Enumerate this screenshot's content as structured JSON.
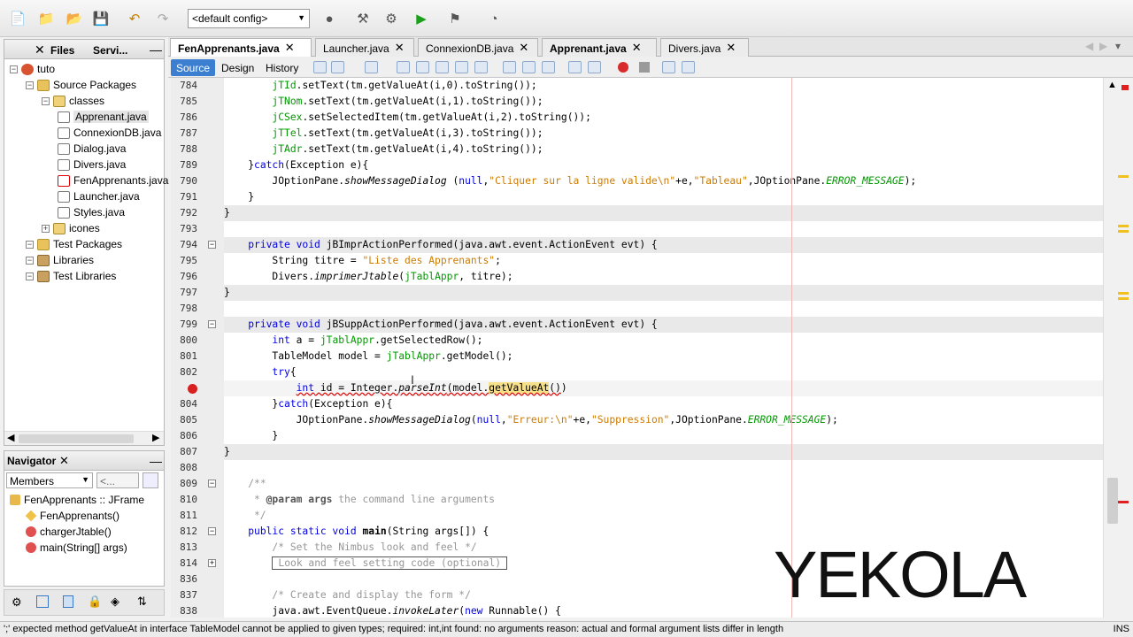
{
  "toolbar": {
    "config": "<default config>"
  },
  "projects_panel": {
    "tabs": [
      "Files",
      "Servi..."
    ],
    "tree": [
      {
        "label": "tuto",
        "depth": 0,
        "icon": "project-icon"
      },
      {
        "label": "Source Packages",
        "depth": 1,
        "icon": "package-folder-icon"
      },
      {
        "label": "classes",
        "depth": 2,
        "icon": "package-icon"
      },
      {
        "label": "Apprenant.java",
        "depth": 3,
        "icon": "java-file-icon",
        "selected": true
      },
      {
        "label": "ConnexionDB.java",
        "depth": 3,
        "icon": "java-file-icon"
      },
      {
        "label": "Dialog.java",
        "depth": 3,
        "icon": "java-file-icon"
      },
      {
        "label": "Divers.java",
        "depth": 3,
        "icon": "java-file-icon"
      },
      {
        "label": "FenApprenants.java",
        "depth": 3,
        "icon": "java-file-error-icon"
      },
      {
        "label": "Launcher.java",
        "depth": 3,
        "icon": "java-file-icon"
      },
      {
        "label": "Styles.java",
        "depth": 3,
        "icon": "java-file-icon"
      },
      {
        "label": "icones",
        "depth": 2,
        "icon": "package-icon"
      },
      {
        "label": "Test Packages",
        "depth": 1,
        "icon": "package-folder-icon"
      },
      {
        "label": "Libraries",
        "depth": 1,
        "icon": "library-icon"
      },
      {
        "label": "Test Libraries",
        "depth": 1,
        "icon": "library-icon"
      }
    ]
  },
  "navigator": {
    "title": "Navigator",
    "filter": "Members",
    "filter2": "<...",
    "items": [
      {
        "label": "FenApprenants :: JFrame",
        "depth": 0
      },
      {
        "label": "FenApprenants()",
        "depth": 1
      },
      {
        "label": "chargerJtable()",
        "depth": 1
      },
      {
        "label": "main(String[] args)",
        "depth": 1
      }
    ]
  },
  "editor": {
    "tabs": [
      {
        "label": "FenApprenants.java",
        "active": true
      },
      {
        "label": "Launcher.java"
      },
      {
        "label": "ConnexionDB.java"
      },
      {
        "label": "Apprenant.java",
        "bold": true
      },
      {
        "label": "Divers.java"
      }
    ],
    "modes": [
      "Source",
      "Design",
      "History"
    ],
    "lines": [
      {
        "n": "784",
        "html": "        <span class='fld'>jTId</span>.setText(tm.getValueAt(i,0).toString());"
      },
      {
        "n": "785",
        "html": "        <span class='fld'>jTNom</span>.setText(tm.getValueAt(i,1).toString());"
      },
      {
        "n": "786",
        "html": "        <span class='fld'>jCSex</span>.setSelectedItem(tm.getValueAt(i,2).toString());"
      },
      {
        "n": "787",
        "html": "        <span class='fld'>jTTel</span>.setText(tm.getValueAt(i,3).toString());"
      },
      {
        "n": "788",
        "html": "        <span class='fld'>jTAdr</span>.setText(tm.getValueAt(i,4).toString());"
      },
      {
        "n": "789",
        "html": "    }<span class='kw'>catch</span>(Exception e){"
      },
      {
        "n": "790",
        "html": "        JOptionPane.<span class='it'>showMessageDialog</span> (<span class='kw'>null</span>,<span class='str'>\"Cliquer sur la ligne valide\\n\"</span>+e,<span class='str'>\"Tableau\"</span>,JOptionPane.<span class='cst'>ERROR_MESSAGE</span>);"
      },
      {
        "n": "791",
        "html": "    }"
      },
      {
        "n": "792",
        "html": "}",
        "cls": "hl"
      },
      {
        "n": "793",
        "html": ""
      },
      {
        "n": "794",
        "html": "    <span class='kw'>private void</span> jBImprActionPerformed(java.awt.event.ActionEvent evt) {",
        "cls": "hl",
        "fold": "-"
      },
      {
        "n": "795",
        "html": "        String titre = <span class='str'>\"Liste des Apprenants\"</span>;"
      },
      {
        "n": "796",
        "html": "        Divers.<span class='it'>imprimerJtable</span>(<span class='fld'>jTablAppr</span>, titre);"
      },
      {
        "n": "797",
        "html": "}",
        "cls": "hl"
      },
      {
        "n": "798",
        "html": ""
      },
      {
        "n": "799",
        "html": "    <span class='kw'>private void</span> jBSuppActionPerformed(java.awt.event.ActionEvent evt) {",
        "cls": "hl",
        "fold": "-"
      },
      {
        "n": "800",
        "html": "        <span class='kw'>int</span> a = <span class='fld'>jTablAppr</span>.getSelectedRow();"
      },
      {
        "n": "801",
        "html": "        TableModel model = <span class='fld'>jTablAppr</span>.getModel();"
      },
      {
        "n": "802",
        "html": "        <span class='kw'>try</span>{"
      },
      {
        "n": "803",
        "html": "            <span class='err'><span class='kw'>int</span> id = Integer.<span class='it'>parseInt</span>(model.<span style='background:#f7e08a'>getValueAt</span>()</span>)",
        "cls": "cur",
        "error": true
      },
      {
        "n": "804",
        "html": "        }<span class='kw'>catch</span>(Exception e){"
      },
      {
        "n": "805",
        "html": "            JOptionPane.<span class='it'>showMessageDialog</span>(<span class='kw'>null</span>,<span class='str'>\"Erreur:\\n\"</span>+e,<span class='str'>\"Suppression\"</span>,JOptionPane.<span class='cst'>ERROR_MESSAGE</span>);"
      },
      {
        "n": "806",
        "html": "        }"
      },
      {
        "n": "807",
        "html": "}",
        "cls": "hl"
      },
      {
        "n": "808",
        "html": ""
      },
      {
        "n": "809",
        "html": "    <span class='cm'>/**</span>",
        "fold": "-"
      },
      {
        "n": "810",
        "html": "<span class='cm'>     * <b style='color:#555'>@param</b> <b style='color:#555'>args</b> the command line arguments</span>"
      },
      {
        "n": "811",
        "html": "<span class='cm'>     */</span>"
      },
      {
        "n": "812",
        "html": "    <span class='kw'>public static void</span> <b>main</b>(String args[]) {",
        "fold": "-"
      },
      {
        "n": "813",
        "html": "        <span class='cm'>/* Set the Nimbus look and feel */</span>"
      },
      {
        "n": "814",
        "html": "        <span style='border:1px solid #555;padding:0 6px'><span class='cm'>Look and feel setting code (optional)</span></span>",
        "fold": "+"
      },
      {
        "n": "836",
        "html": ""
      },
      {
        "n": "837",
        "html": "        <span class='cm'>/* Create and display the form */</span>"
      },
      {
        "n": "838",
        "html": "        java.awt.EventQueue.<span class='it'>invokeLater</span>(<span class='kw'>new</span> Runnable() {"
      }
    ]
  },
  "status": {
    "message": "';' expected  method getValueAt in interface TableModel cannot be applied to given types;   required: int,int   found: no arguments   reason: actual and formal argument lists differ in length",
    "mode": "INS"
  },
  "watermark": {
    "text": "YEKOLA"
  }
}
